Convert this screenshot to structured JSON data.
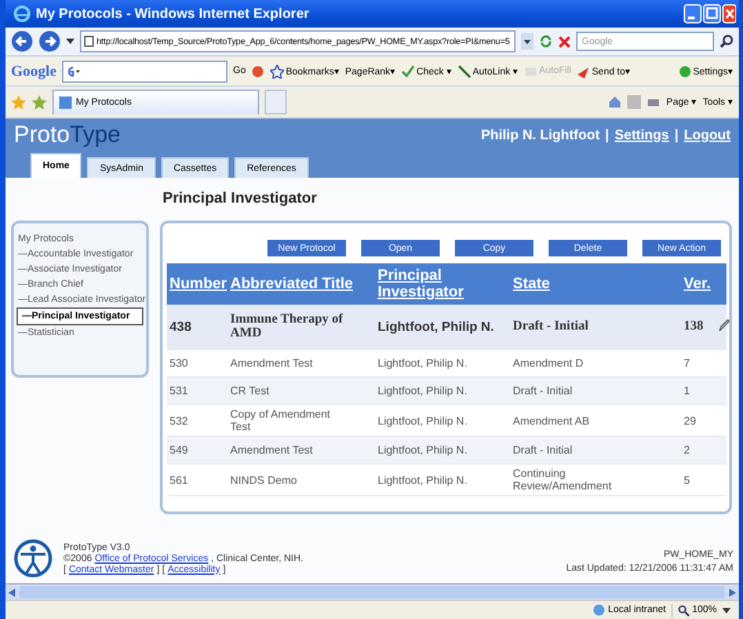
{
  "window": {
    "title": "My Protocols - Windows Internet Explorer"
  },
  "address_bar": {
    "url": "http://localhost/Temp_Source/ProtoType_App_6/contents/home_pages/PW_HOME_MY.aspx?role=PI&menu=5",
    "search_placeholder": "Google"
  },
  "google_toolbar": {
    "logo": "Google",
    "items": [
      {
        "label": "Go",
        "disabled": false
      },
      {
        "label": "Bookmarks▾",
        "disabled": false
      },
      {
        "label": "PageRank▾",
        "disabled": false
      },
      {
        "label": "Check ▾",
        "disabled": false
      },
      {
        "label": "AutoLink ▾",
        "disabled": false
      },
      {
        "label": "AutoFill",
        "disabled": true
      },
      {
        "label": "Send to▾",
        "disabled": false
      },
      {
        "label": "Settings▾",
        "disabled": false
      }
    ]
  },
  "browser_tab": {
    "label": "My Protocols"
  },
  "command_bar": [
    "Page ▾",
    "Tools ▾"
  ],
  "app": {
    "brand_light": "Proto",
    "brand_dark": "Type",
    "user": "Philip N. Lightfoot",
    "separator": "|",
    "links": [
      "Settings",
      "Logout"
    ]
  },
  "tabs": [
    {
      "label": "Home",
      "selected": true
    },
    {
      "label": "SysAdmin",
      "selected": false
    },
    {
      "label": "Cassettes",
      "selected": false
    },
    {
      "label": "References",
      "selected": false
    }
  ],
  "heading": "Principal Investigator",
  "sidebar": {
    "title": "My Protocols",
    "items": [
      {
        "label": "—Accountable Investigator",
        "selected": false
      },
      {
        "label": "—Associate Investigator",
        "selected": false
      },
      {
        "label": "—Branch Chief",
        "selected": false
      },
      {
        "label": "—Lead Associate Investigator",
        "selected": false
      },
      {
        "label": "—Principal Investigator",
        "selected": true
      },
      {
        "label": "—Statistician",
        "selected": false
      }
    ]
  },
  "actions": [
    "New Protocol",
    "Open",
    "Copy",
    "Delete",
    "New Action"
  ],
  "table": {
    "columns": [
      "Number",
      "Abbreviated Title",
      "Principal Investigator",
      "State",
      "Ver."
    ],
    "rows": [
      {
        "cells": [
          "438",
          "Immune Therapy of AMD",
          "Lightfoot, Philip N.",
          "Draft - Initial",
          "138"
        ],
        "selected": true
      },
      {
        "cells": [
          "530",
          "Amendment Test",
          "Lightfoot, Philip N.",
          "Amendment D",
          "7"
        ],
        "selected": false
      },
      {
        "cells": [
          "531",
          "CR Test",
          "Lightfoot, Philip N.",
          "Draft - Initial",
          "1"
        ],
        "selected": false
      },
      {
        "cells": [
          "532",
          "Copy of Amendment Test",
          "Lightfoot, Philip N.",
          "Amendment AB",
          "29"
        ],
        "selected": false
      },
      {
        "cells": [
          "549",
          "Amendment Test",
          "Lightfoot, Philip N.",
          "Draft - Initial",
          "2"
        ],
        "selected": false
      },
      {
        "cells": [
          "561",
          "NINDS Demo",
          "Lightfoot, Philip N.",
          "Continuing Review/Amendment",
          "5"
        ],
        "selected": false
      }
    ]
  },
  "footer": {
    "version": "ProtoType V3.0",
    "copyright": "©2006",
    "office_link": "Office of Protocol Services",
    "institution": ", Clinical Center, NIH.",
    "bracket_open": "[",
    "bracket_close": "]",
    "links": [
      "Contact Webmaster",
      "Accessibility"
    ],
    "page_id": "PW_HOME_MY",
    "updated": "Last Updated: 12/21/2006 11:31:47 AM"
  },
  "status_bar": {
    "zone": "Local intranet",
    "zoom": "100%"
  }
}
